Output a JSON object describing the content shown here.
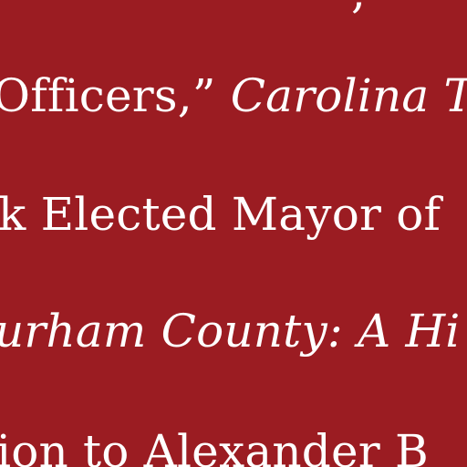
{
  "document": {
    "background_color": "#9b1c22",
    "text_color": "#ffffff",
    "lines": [
      {
        "segments": [
          {
            "text": ",",
            "italic": false
          }
        ]
      },
      {
        "segments": [
          {
            "text": "Officers,” ",
            "italic": false
          },
          {
            "text": "Carolina Ti",
            "italic": true
          }
        ]
      },
      {
        "segments": [
          {
            "text": "k Elected Mayor of",
            "italic": false
          }
        ]
      },
      {
        "segments": [
          {
            "text": "urham County: A Hi",
            "italic": true
          }
        ]
      },
      {
        "segments": [
          {
            "text": "ion to Alexander B",
            "italic": false
          }
        ]
      }
    ]
  }
}
